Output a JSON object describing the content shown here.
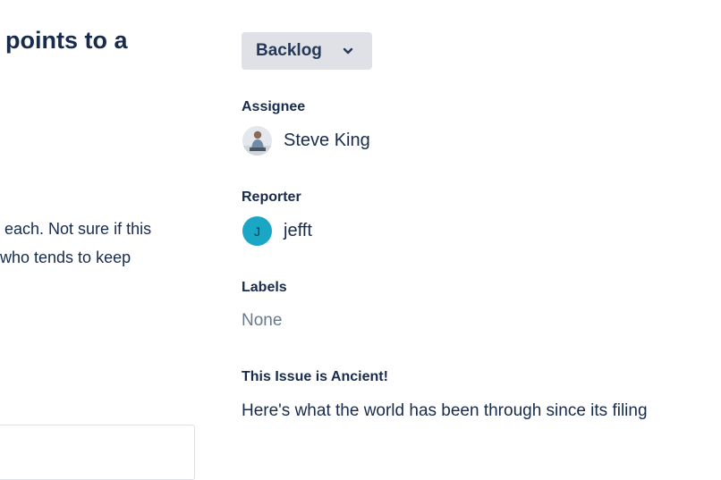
{
  "issue": {
    "title_fragment": "points to a",
    "description_lines": [
      " each. Not sure if this",
      "who tends to keep"
    ]
  },
  "status": {
    "label": "Backlog",
    "icon": "chevron-down-icon"
  },
  "assignee": {
    "label": "Assignee",
    "name": "Steve King",
    "avatar_icon": "user-photo-avatar"
  },
  "reporter": {
    "label": "Reporter",
    "name": "jefft",
    "avatar_initial": "J",
    "avatar_color": "#1aa6c5"
  },
  "labels": {
    "label": "Labels",
    "value": "None"
  },
  "ancient": {
    "label": "This Issue is Ancient!",
    "text": "Here's what the world has been through since its filing"
  },
  "colors": {
    "text": "#172b4d",
    "muted": "#6b778c",
    "button_bg": "#dfe1e6"
  }
}
